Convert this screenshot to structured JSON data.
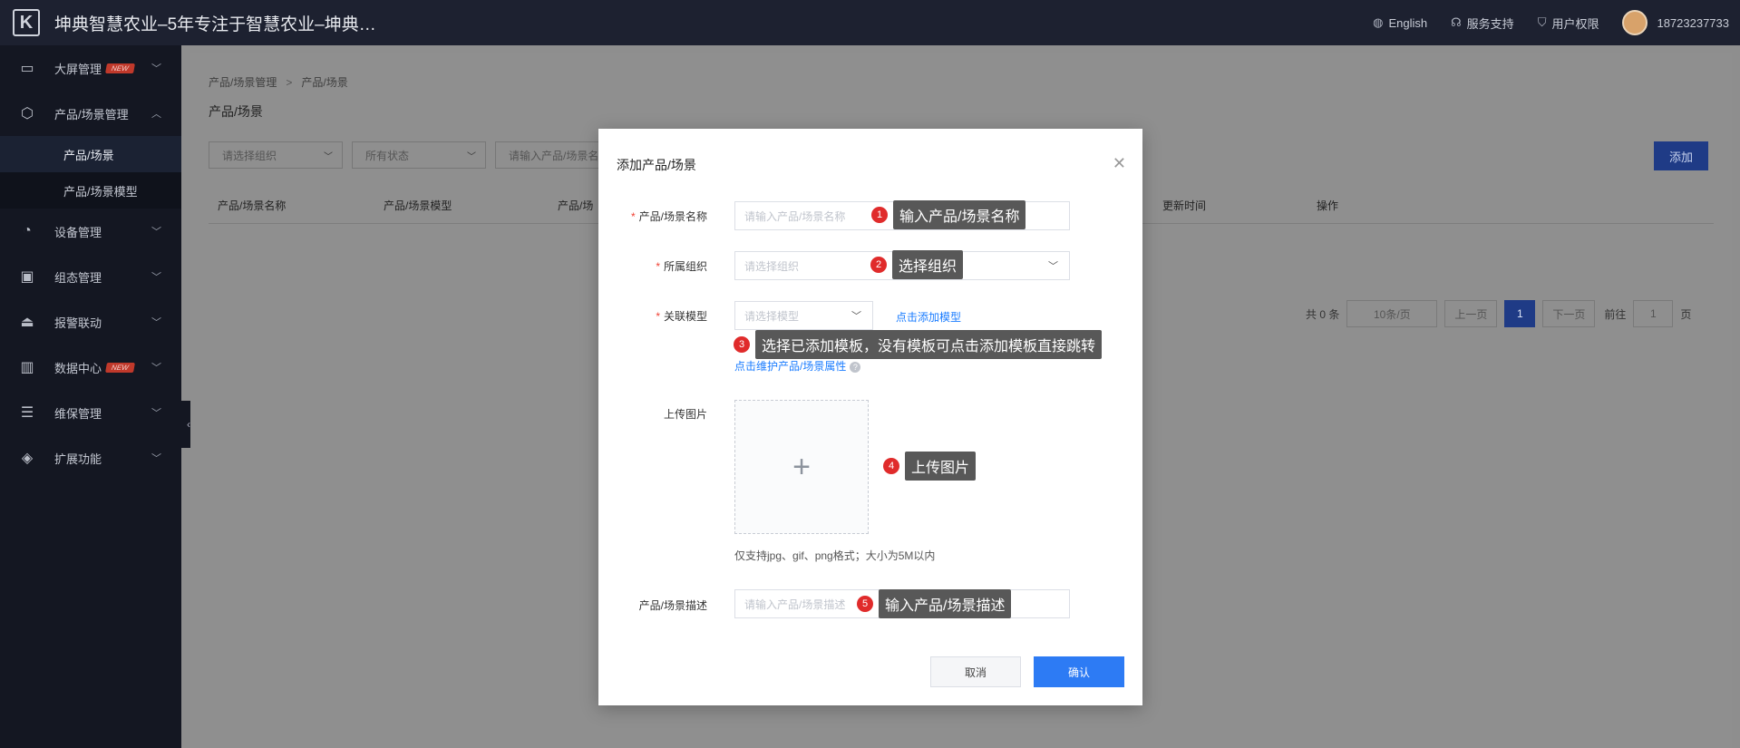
{
  "header": {
    "title": "坤典智慧农业–5年专注于智慧农业–坤典…",
    "language": "English",
    "support": "服务支持",
    "permissions": "用户权限",
    "phone": "18723237733"
  },
  "sidebar": {
    "items": [
      {
        "label": "大屏管理",
        "icon": "monitor-icon",
        "tag": "NEW"
      },
      {
        "label": "产品/场景管理",
        "icon": "cube-icon"
      },
      {
        "label": "设备管理",
        "icon": "pie-chart-icon"
      },
      {
        "label": "组态管理",
        "icon": "image-icon"
      },
      {
        "label": "报警联动",
        "icon": "alarm-icon"
      },
      {
        "label": "数据中心",
        "icon": "bar-chart-icon",
        "tag": "NEW"
      },
      {
        "label": "维保管理",
        "icon": "maintenance-icon"
      },
      {
        "label": "扩展功能",
        "icon": "layers-icon"
      }
    ],
    "subitems": [
      {
        "label": "产品/场景",
        "active": true
      },
      {
        "label": "产品/场景模型",
        "active": false
      }
    ]
  },
  "page": {
    "breadcrumb": [
      "产品/场景管理",
      "产品/场景"
    ],
    "title": "产品/场景",
    "filters": [
      "请选择组织",
      "所有状态",
      "请输入产品/场景名"
    ],
    "add_label": "添加",
    "columns": [
      "产品/场景名称",
      "产品/场景模型",
      "产品/场",
      "更新时间",
      "操作"
    ],
    "pager": {
      "total": "共 0 条",
      "page_size": "10条/页",
      "prev": "上一页",
      "current": "1",
      "next": "下一页",
      "goto_label": "前往",
      "goto_value": "1",
      "page_unit": "页"
    }
  },
  "modal": {
    "title": "添加产品/场景",
    "fields": {
      "name_label": "产品/场景名称",
      "name_placeholder": "请输入产品/场景名称",
      "org_label": "所属组织",
      "org_placeholder": "请选择组织",
      "model_label": "关联模型",
      "model_placeholder": "请选择模型",
      "add_model_link": "点击添加模型",
      "maintain_link": "点击维护产品/场景属性",
      "upload_label": "上传图片",
      "upload_hint": "仅支持jpg、gif、png格式；大小为5M以内",
      "desc_label": "产品/场景描述",
      "desc_placeholder": "请输入产品/场景描述"
    },
    "cancel_label": "取消",
    "confirm_label": "确认"
  },
  "steps": [
    {
      "num": "1",
      "text": "输入产品/场景名称"
    },
    {
      "num": "2",
      "text": "选择组织"
    },
    {
      "num": "3",
      "text": "选择已添加模板，没有模板可点击添加模板直接跳转"
    },
    {
      "num": "4",
      "text": "上传图片"
    },
    {
      "num": "5",
      "text": "输入产品/场景描述"
    }
  ],
  "colors": {
    "primary": "#2d7bf4",
    "sidebar": "#141722",
    "topbar": "#1d2130",
    "required": "#f04134",
    "badge": "#e02b2b"
  }
}
